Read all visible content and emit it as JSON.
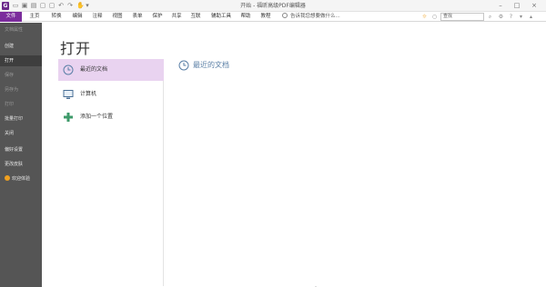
{
  "window": {
    "title": "开始 - 福昕高级PDF编辑器"
  },
  "ribbon": {
    "tabs": [
      "文件",
      "主页",
      "转换",
      "编辑",
      "注释",
      "视图",
      "表单",
      "保护",
      "共享",
      "互联",
      "辅助工具",
      "帮助",
      "教程"
    ],
    "tell_me": "告诉我您想要做什么...",
    "search_placeholder": "查找"
  },
  "sidebar": {
    "items": [
      {
        "label": "文档属性",
        "state": "disabled"
      },
      {
        "label": "创建",
        "state": "normal"
      },
      {
        "label": "打开",
        "state": "active"
      },
      {
        "label": "保存",
        "state": "disabled"
      },
      {
        "label": "另存为",
        "state": "disabled"
      },
      {
        "label": "打印",
        "state": "disabled"
      },
      {
        "label": "批量打印",
        "state": "normal"
      },
      {
        "label": "关闭",
        "state": "normal"
      },
      {
        "label": "偏好设置",
        "state": "normal"
      },
      {
        "label": "更改皮肤",
        "state": "normal"
      },
      {
        "label": "欢迎体验",
        "state": "normal"
      }
    ]
  },
  "main": {
    "title": "打开",
    "places": [
      {
        "label": "最近的文档",
        "icon": "clock-icon",
        "selected": true
      },
      {
        "label": "计算机",
        "icon": "computer-icon",
        "selected": false
      },
      {
        "label": "添加一个位置",
        "icon": "plus-icon",
        "selected": false
      }
    ],
    "right_header": "最近的文档"
  },
  "colors": {
    "accent": "#7b2c9c",
    "sidebar": "#555555",
    "selection": "#e9d3f0",
    "link": "#5a7fa6"
  }
}
